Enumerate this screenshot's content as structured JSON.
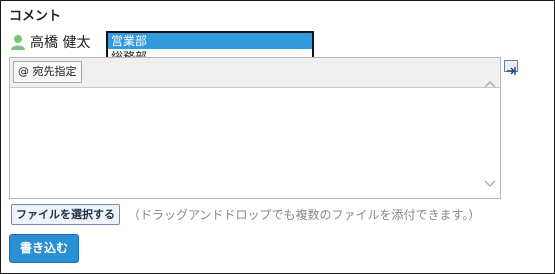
{
  "section_title": "コメント",
  "user": {
    "name": "高橋 健太"
  },
  "dropdown": {
    "options": [
      "営業部",
      "総務部"
    ],
    "selected": "営業部"
  },
  "editor": {
    "mention_button": "@ 宛先指定",
    "text": ""
  },
  "attachment": {
    "button_label": "ファイルを選択する",
    "hint": "（ドラッグアンドドロップでも複数のファイルを添付できます。）"
  },
  "submit_label": "書き込む",
  "colors": {
    "accent": "#2b8fd4",
    "selected_option": "#3399dd",
    "user_icon": "#7ac37a"
  }
}
